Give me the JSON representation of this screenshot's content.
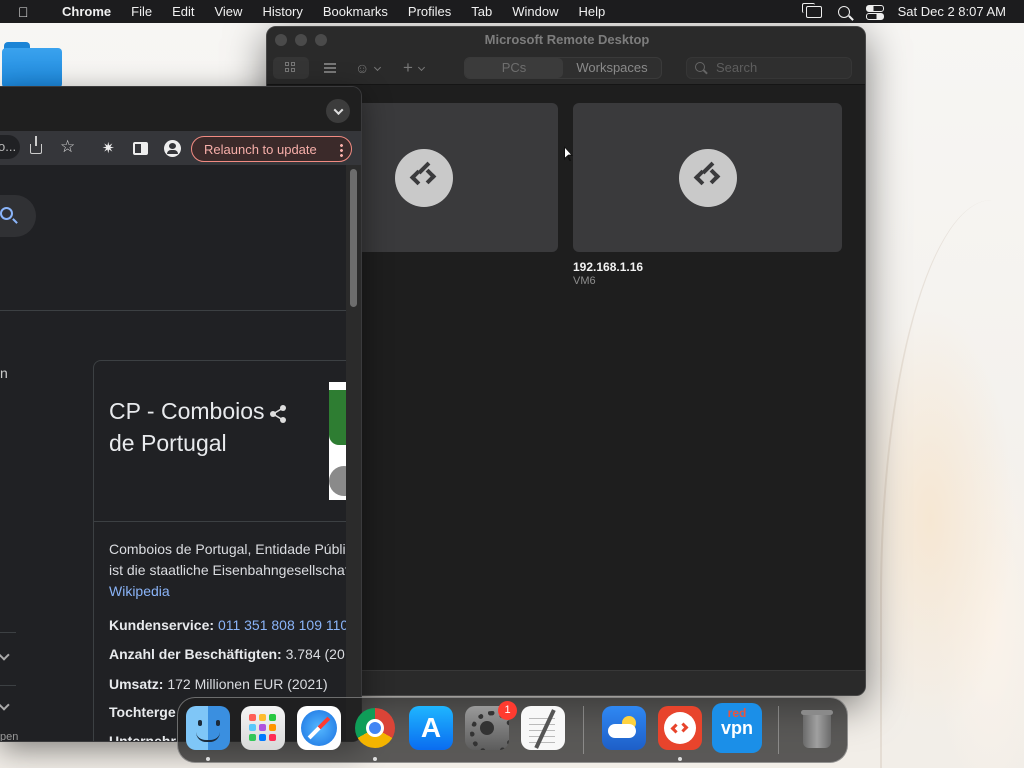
{
  "menubar": {
    "app_name": "Chrome",
    "items": [
      "File",
      "Edit",
      "View",
      "History",
      "Bookmarks",
      "Profiles",
      "Tab",
      "Window",
      "Help"
    ],
    "datetime": "Sat Dec 2  8:07 AM"
  },
  "chrome": {
    "omnibox_fragment": "o...",
    "relaunch_label": "Relaunch to update",
    "side_text": "n",
    "side_small": "pen",
    "knowledge_panel": {
      "title": "CP - Comboios de Portugal",
      "description_line1": "Comboios de Portugal, Entidade Públi",
      "description_line2": "ist die staatliche Eisenbahngesellschaf",
      "source_link": "Wikipedia",
      "facts": [
        {
          "label": "Kundenservice:",
          "value": "011 351 808 109 110",
          "is_link": true
        },
        {
          "label": "Anzahl der Beschäftigten:",
          "value": "3.784 (20",
          "is_link": false
        },
        {
          "label": "Umsatz:",
          "value": "172 Millionen EUR (2021)",
          "is_link": false
        },
        {
          "label": "Tochterge",
          "value": "",
          "is_link": false
        },
        {
          "label": "Unternehr",
          "value": "",
          "is_link": false
        }
      ]
    }
  },
  "remote_desktop": {
    "title": "Microsoft Remote Desktop",
    "segments": [
      "PCs",
      "Workspaces"
    ],
    "active_segment": "PCs",
    "search_placeholder": "Search",
    "pcs": [
      {
        "name": "",
        "subtitle": ""
      },
      {
        "name": "192.168.1.16",
        "subtitle": "VM6"
      }
    ]
  },
  "dock": {
    "apps": [
      {
        "name": "Finder",
        "icon": "finder-icon",
        "running": true
      },
      {
        "name": "Launchpad",
        "icon": "launchpad-icon",
        "running": false
      },
      {
        "name": "Safari",
        "icon": "safari-icon",
        "running": false
      },
      {
        "name": "Google Chrome",
        "icon": "chrome-icon",
        "running": true
      },
      {
        "name": "App Store",
        "icon": "app-store-icon",
        "running": false
      },
      {
        "name": "System Settings",
        "icon": "settings-icon",
        "running": false,
        "badge": "1"
      },
      {
        "name": "TextEdit",
        "icon": "textedit-icon",
        "running": false
      },
      {
        "name": "Weather",
        "icon": "weather-icon",
        "running": false
      },
      {
        "name": "Microsoft Remote Desktop",
        "icon": "remote-desktop-icon",
        "running": true
      },
      {
        "name": "RedVPN",
        "icon": "vpn-icon",
        "running": false,
        "label_top": "red",
        "label_bottom": "vpn"
      },
      {
        "name": "Trash",
        "icon": "trash-icon",
        "running": false
      }
    ]
  },
  "colors": {
    "relaunch_border": "#f28b82",
    "link": "#8ab4f8",
    "remote_desktop_accent": "#e8442c"
  }
}
